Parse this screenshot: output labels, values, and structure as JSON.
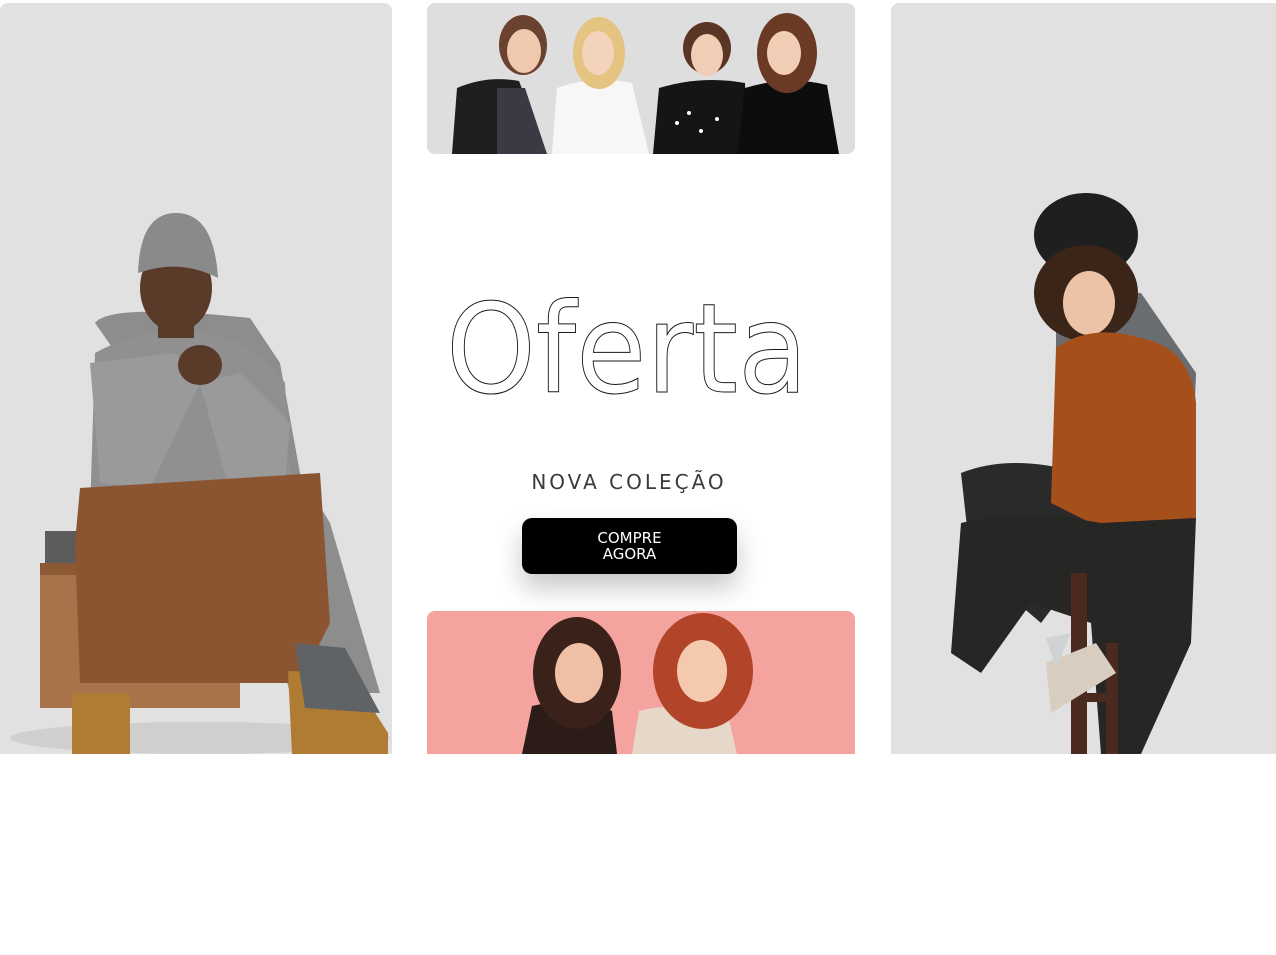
{
  "hero": {
    "headline": "Oferta",
    "subtitle": "NOVA COLEÇÃO",
    "cta_label": "COMPRE AGORA"
  },
  "images": {
    "left": "man-sitting-on-wooden-box-photo",
    "top": "four-women-group-photo",
    "right": "two-men-on-stool-photo",
    "bottom": "two-women-laughing-photo"
  },
  "colors": {
    "panel_gray": "#e1e1e1",
    "bottom_panel_pink": "#f4a39f",
    "button_bg": "#000000",
    "button_text": "#ffffff",
    "subtitle_text": "#3a3a3a"
  }
}
